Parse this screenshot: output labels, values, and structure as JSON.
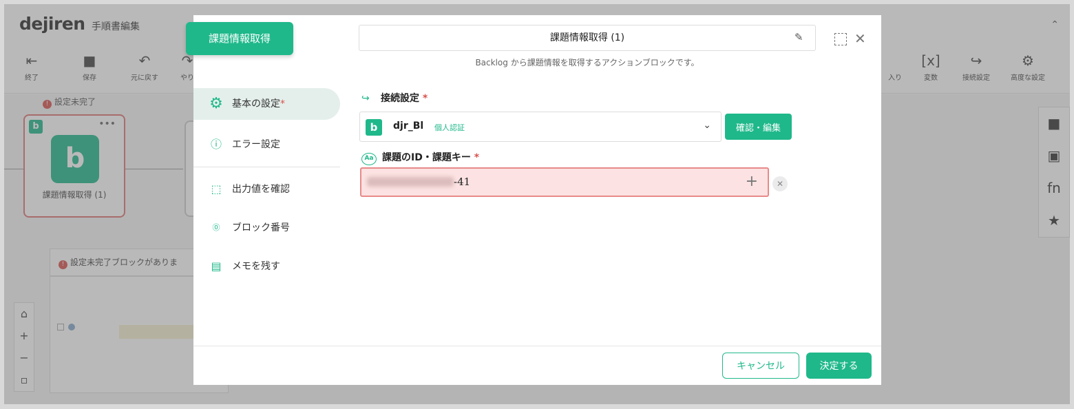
{
  "app": {
    "logo": "dejiren",
    "title": "手順書編集",
    "collapse_icon": "chevrons-up-icon"
  },
  "toolbar": {
    "left_items": [
      {
        "label": "終了",
        "icon": "exit-icon"
      },
      {
        "label": "保存",
        "icon": "save-icon"
      },
      {
        "label": "元に戻す",
        "icon": "undo-icon"
      },
      {
        "label": "やり",
        "icon": "redo-icon"
      }
    ],
    "right_items": [
      {
        "label": "入り",
        "icon": "import-icon"
      },
      {
        "label": "変数",
        "icon": "variable-icon"
      },
      {
        "label": "接続設定",
        "icon": "connection-icon"
      },
      {
        "label": "高度な設定",
        "icon": "advanced-settings-icon"
      }
    ]
  },
  "canvas": {
    "warning_label": "設定未完了",
    "block_name": "課題情報取得 (1)",
    "block_badge": "b",
    "incomplete_message": "設定未完了ブロックがありま"
  },
  "dialog": {
    "tag": "課題情報取得",
    "title": "課題情報取得 (1)",
    "description": "Backlog から課題情報を取得するアクションブロックです。",
    "menu": [
      {
        "label": "基本の設定",
        "required": "*",
        "icon": "gear-icon",
        "active": true
      },
      {
        "label": "エラー設定",
        "icon": "error-icon"
      },
      {
        "label": "出力値を確認",
        "icon": "output-icon"
      },
      {
        "label": "ブロック番号",
        "icon": "number-icon"
      },
      {
        "label": "メモを残す",
        "icon": "memo-icon"
      }
    ],
    "connection": {
      "heading": "接続設定",
      "required": "*",
      "badge": "b",
      "name": "djr_Bl",
      "auth_tag": "個人認証",
      "confirm_button": "確認・編集"
    },
    "issue": {
      "heading": "課題のID・課題キー",
      "required": "*",
      "icon_text": "Aa",
      "value": "-41"
    },
    "footer": {
      "cancel": "キャンセル",
      "ok": "決定する"
    }
  }
}
